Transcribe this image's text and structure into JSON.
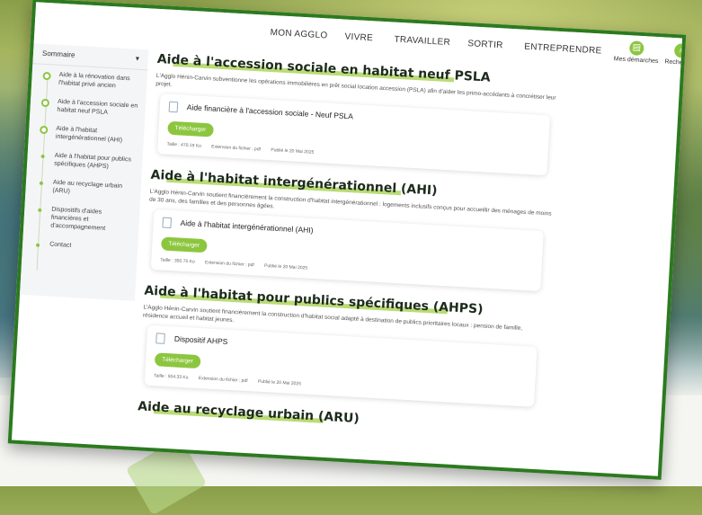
{
  "topnav": {
    "items": [
      "MON AGGLO",
      "VIVRE",
      "TRAVAILLER",
      "SORTIR",
      "ENTREPRENDRE"
    ],
    "tools": [
      {
        "label": "Mes démarches",
        "icon": "folder-icon"
      },
      {
        "label": "Rechercher",
        "icon": "search-icon"
      }
    ]
  },
  "sidebar": {
    "title": "Sommaire",
    "items": [
      {
        "label": "Aide à la rénovation dans l'habitat privé ancien"
      },
      {
        "label": "Aide à l'accession sociale en habitat neuf PSLA"
      },
      {
        "label": "Aide à l'habitat intergénérationnel (AHI)"
      },
      {
        "label": "Aide à l'habitat pour publics spécifiques (AHPS)"
      },
      {
        "label": "Aide au recyclage urbain (ARU)"
      },
      {
        "label": "Dispositifs d'aides financières et d'accompagnement"
      },
      {
        "label": "Contact"
      }
    ]
  },
  "sections": [
    {
      "title": "Aide à l'accession sociale en habitat neuf PSLA",
      "text": "L'Agglo Hénin-Carvin subventionne les opérations immobilières en prêt social location accession (PSLA) afin d'aider les primo-accédants à concrétiser leur projet.",
      "file": {
        "title": "Aide financière à l'accession sociale - Neuf PSLA",
        "button": "Télécharger",
        "size": "Taille : 470.19 Ko",
        "ext": "Extension du fichier : pdf",
        "date": "Publié le 20 Mai 2025"
      }
    },
    {
      "title": "Aide à l'habitat intergénérationnel (AHI)",
      "text": "L'Agglo Hénin-Carvin soutient financièrement la construction d'habitat intergénérationnel : logements inclusifs conçus pour accueillir des ménages de moins de 30 ans, des familles et des personnes âgées.",
      "file": {
        "title": "Aide à l'habitat intergénérationnel (AHI)",
        "button": "Télécharger",
        "size": "Taille : 350.75 Ko",
        "ext": "Extension du fichier : pdf",
        "date": "Publié le 20 Mai 2025"
      }
    },
    {
      "title": "Aide à l'habitat pour publics spécifiques (AHPS)",
      "text": "L'Agglo Hénin-Carvin soutient financièrement la construction d'habitat social adapté à destination de publics prioritaires locaux : pension de famille, résidence accueil et habitat jeunes.",
      "file": {
        "title": "Dispositif AHPS",
        "button": "Télécharger",
        "size": "Taille : 554.33 Ko",
        "ext": "Extension du fichier : pdf",
        "date": "Publié le 20 Mai 2025"
      }
    },
    {
      "title": "Aide au recyclage urbain (ARU)"
    }
  ],
  "colors": {
    "accent": "#8cc63f",
    "frame": "#2c7a1f"
  }
}
